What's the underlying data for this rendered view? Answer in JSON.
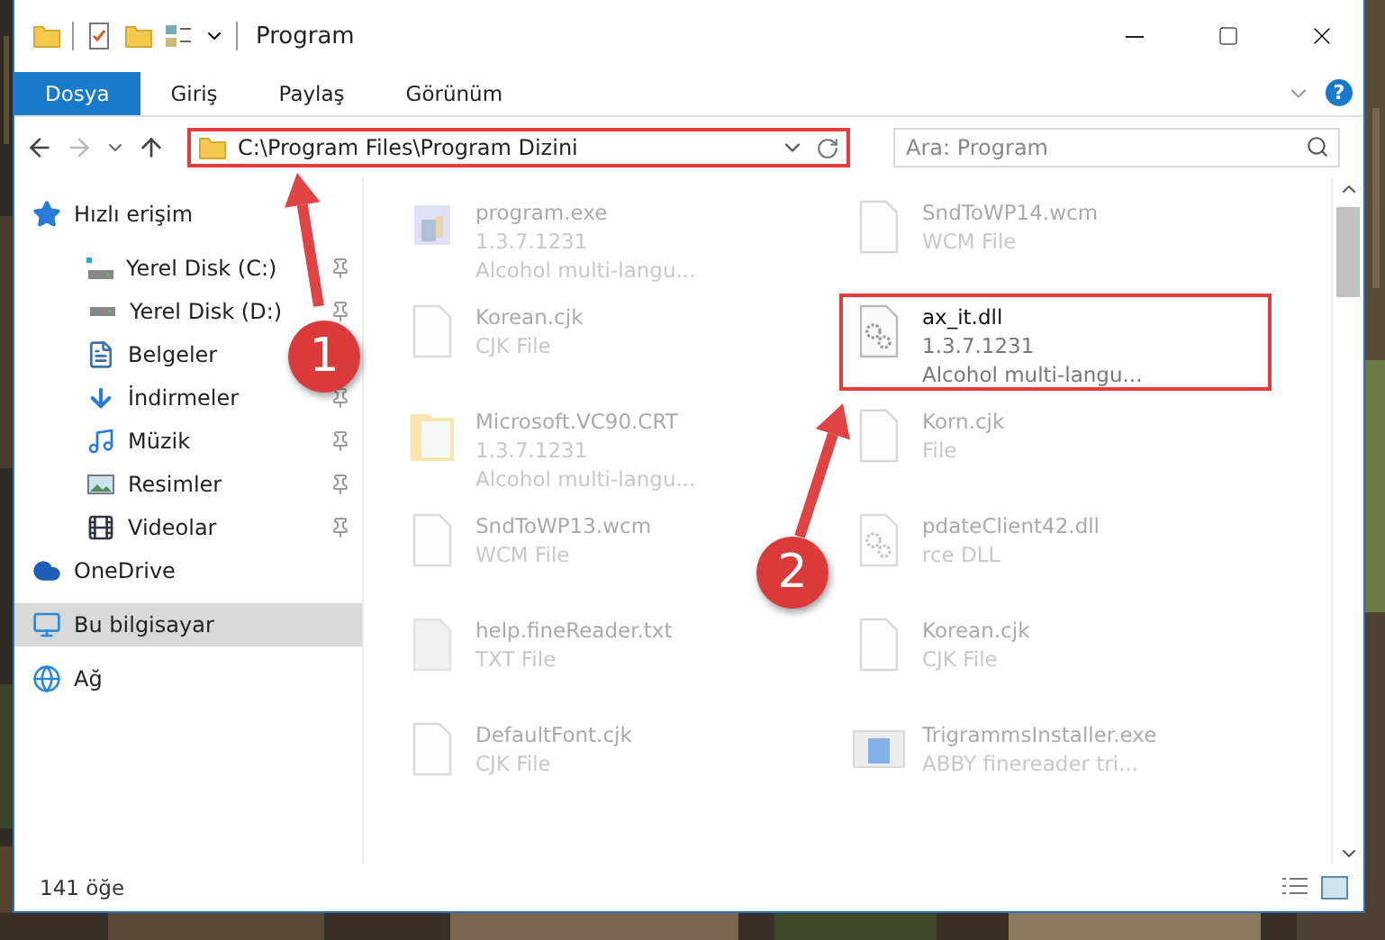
{
  "window": {
    "title": "Program"
  },
  "ribbon": {
    "tabs": [
      {
        "label": "Dosya",
        "selected": true
      },
      {
        "label": "Giriş",
        "selected": false
      },
      {
        "label": "Paylaş",
        "selected": false
      },
      {
        "label": "Görünüm",
        "selected": false
      }
    ],
    "help": "?"
  },
  "nav": {
    "back_disabled": false,
    "forward_disabled": true
  },
  "address": {
    "path": "C:\\Program Files\\Program Dizini",
    "outlined": true
  },
  "search": {
    "placeholder": "Ara: Program"
  },
  "sidebar": {
    "items": [
      {
        "label": "Hızlı erişim",
        "kind": "star",
        "selected": false,
        "children": [
          {
            "label": "Yerel Disk (C:)",
            "kind": "drive-c",
            "pinned": true
          },
          {
            "label": "Yerel Disk (D:)",
            "kind": "drive",
            "pinned": true
          },
          {
            "label": "Belgeler",
            "kind": "document"
          },
          {
            "label": "İndirmeler",
            "kind": "download",
            "pinned": true
          },
          {
            "label": "Müzik",
            "kind": "music",
            "pinned": true
          },
          {
            "label": "Resimler",
            "kind": "pictures",
            "pinned": true
          },
          {
            "label": "Videolar",
            "kind": "video",
            "pinned": true
          }
        ]
      },
      {
        "label": "OneDrive",
        "kind": "cloud",
        "selected": false
      },
      {
        "label": "Bu bilgisayar",
        "kind": "computer",
        "selected": true
      },
      {
        "label": "Ağ",
        "kind": "network",
        "selected": false
      }
    ]
  },
  "files": [
    {
      "name": "program.exe",
      "details": [
        "1.3.7.1231",
        "Alcohol multi-langu..."
      ],
      "kind": "exe",
      "faded": true,
      "outlined": false
    },
    {
      "name": "SndToWP14.wcm",
      "details": [
        "WCM File"
      ],
      "kind": "blank",
      "faded": true,
      "outlined": false
    },
    {
      "name": "Korean.cjk",
      "details": [
        "CJK File"
      ],
      "kind": "blank",
      "faded": true,
      "outlined": false
    },
    {
      "name": "ax_it.dll",
      "details": [
        "1.3.7.1231",
        "Alcohol multi-langu..."
      ],
      "kind": "dll",
      "faded": false,
      "outlined": true
    },
    {
      "name": "Microsoft.VC90.CRT",
      "details": [
        "1.3.7.1231",
        "Alcohol multi-langu..."
      ],
      "kind": "folder",
      "faded": true,
      "outlined": false
    },
    {
      "name": "Korn.cjk",
      "details": [
        "File"
      ],
      "kind": "blank",
      "faded": true,
      "outlined": false
    },
    {
      "name": "SndToWP13.wcm",
      "details": [
        "WCM File"
      ],
      "kind": "blank",
      "faded": true,
      "outlined": false
    },
    {
      "name": "pdateClient42.dll",
      "details": [
        "rce DLL"
      ],
      "kind": "dll",
      "faded": true,
      "outlined": false
    },
    {
      "name": "help.fineReader.txt",
      "details": [
        "TXT File"
      ],
      "kind": "txt",
      "faded": true,
      "outlined": false
    },
    {
      "name": "Korean.cjk",
      "details": [
        "CJK File"
      ],
      "kind": "blank",
      "faded": true,
      "outlined": false
    },
    {
      "name": "DefaultFont.cjk",
      "details": [
        "CJK File"
      ],
      "kind": "blank",
      "faded": true,
      "outlined": false
    },
    {
      "name": "TrigrammsInstaller.exe",
      "details": [
        "ABBY finereader tri..."
      ],
      "kind": "installer",
      "faded": true,
      "outlined": false
    }
  ],
  "status_bar": {
    "count": "141 öğe"
  },
  "annotations": [
    {
      "kind": "callout",
      "label": "1"
    },
    {
      "kind": "callout",
      "label": "2"
    }
  ]
}
